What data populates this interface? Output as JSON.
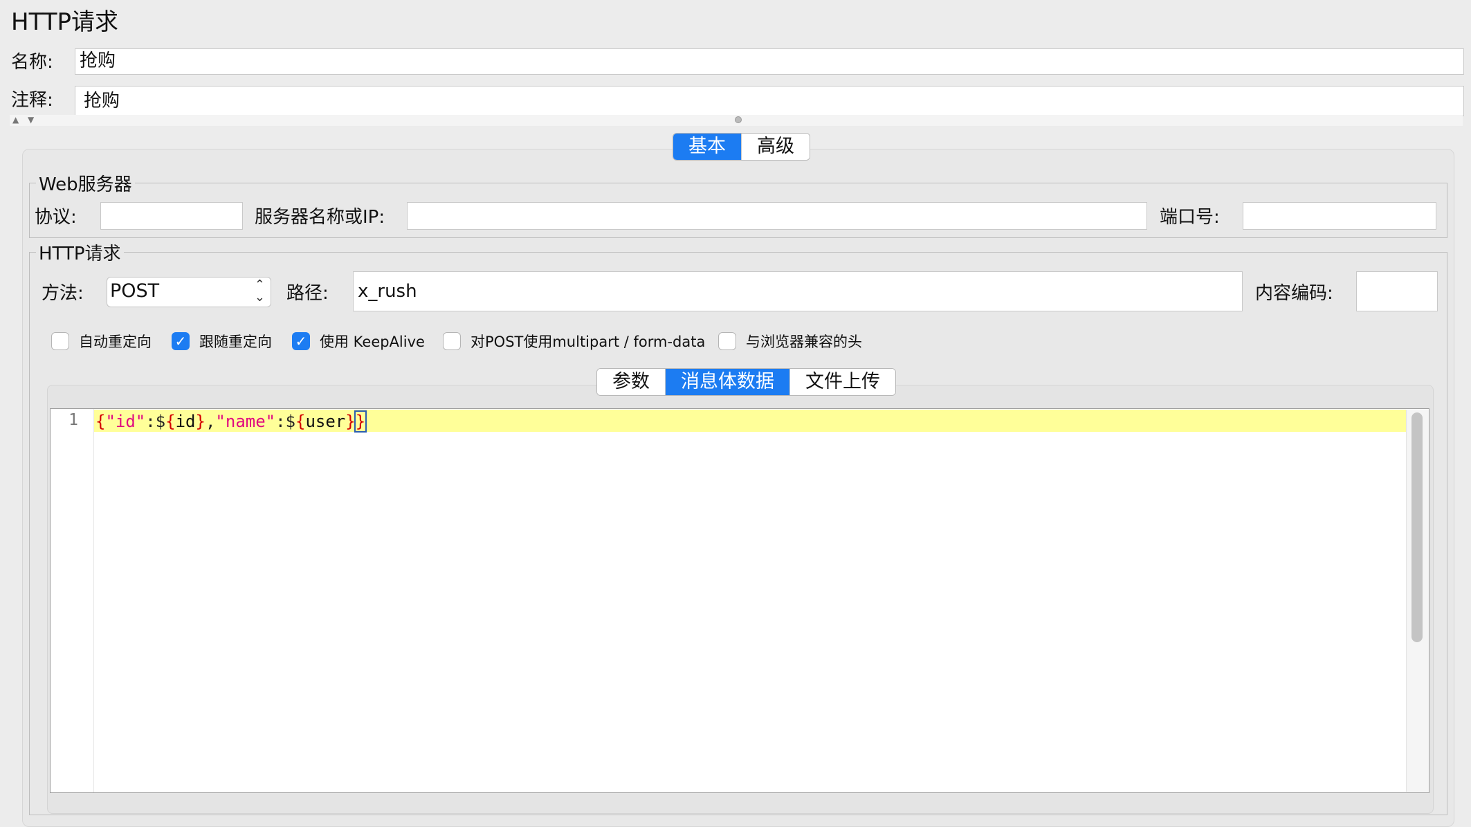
{
  "header": {
    "title": "HTTP请求",
    "name_label": "名称:",
    "name_value": "抢购",
    "comment_label": "注释:",
    "comment_value": "抢购"
  },
  "main_tabs": [
    {
      "label": "基本",
      "active": true
    },
    {
      "label": "高级",
      "active": false
    }
  ],
  "web_server": {
    "group_title": "Web服务器",
    "protocol_label": "协议:",
    "protocol_value": "",
    "server_label": "服务器名称或IP:",
    "server_value": "",
    "port_label": "端口号:",
    "port_value": ""
  },
  "http_request": {
    "group_title": "HTTP请求",
    "method_label": "方法:",
    "method_value": "POST",
    "path_label": "路径:",
    "path_value": "x_rush",
    "encoding_label": "内容编码:",
    "encoding_value": ""
  },
  "options": [
    {
      "label": "自动重定向",
      "checked": false
    },
    {
      "label": "跟随重定向",
      "checked": true
    },
    {
      "label": "使用 KeepAlive",
      "checked": true
    },
    {
      "label": "对POST使用multipart / form-data",
      "checked": false
    },
    {
      "label": "与浏览器兼容的头",
      "checked": false
    }
  ],
  "body_tabs": [
    {
      "label": "参数",
      "active": false
    },
    {
      "label": "消息体数据",
      "active": true
    },
    {
      "label": "文件上传",
      "active": false
    }
  ],
  "editor": {
    "line_number": "1",
    "tokens": {
      "t1": "{",
      "t2": "\"id\"",
      "t3": ":$",
      "t4": "{",
      "t5": "id",
      "t6": "}",
      "t7": ",",
      "t8": "\"name\"",
      "t9": ":$",
      "t10": "{",
      "t11": "user",
      "t12": "}",
      "t13": "}"
    }
  },
  "colors": {
    "accent": "#1c7cf2",
    "current_line": "#ffff99",
    "brace": "#d40000",
    "string": "#e00a80"
  }
}
